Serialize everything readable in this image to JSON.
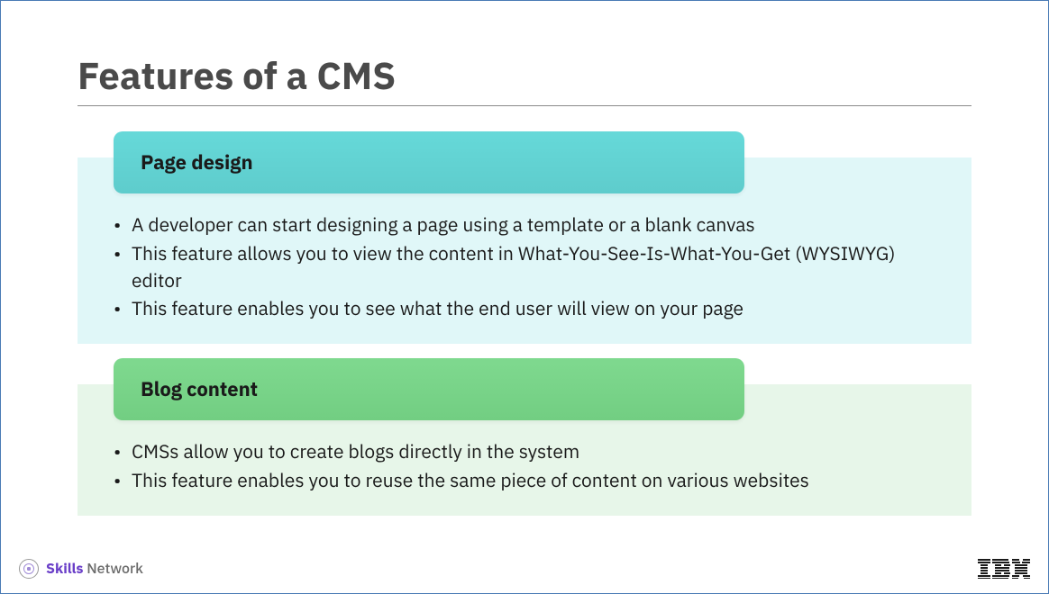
{
  "slide": {
    "title": "Features of a CMS",
    "sections": [
      {
        "header": "Page design",
        "bullets": [
          "A developer can start designing a page using a template or a blank canvas",
          "This feature allows you to view the content in What-You-See-Is-What-You-Get (WYSIWYG) editor",
          "This feature enables you to see what the end user will view on your page"
        ]
      },
      {
        "header": "Blog content",
        "bullets": [
          "CMSs allow you to create blogs directly in the system",
          "This feature enables you to reuse the same piece of content on various websites"
        ]
      }
    ]
  },
  "footer": {
    "skills_label_bold": "Skills",
    "skills_label_light": " Network",
    "vendor": "IBM"
  }
}
